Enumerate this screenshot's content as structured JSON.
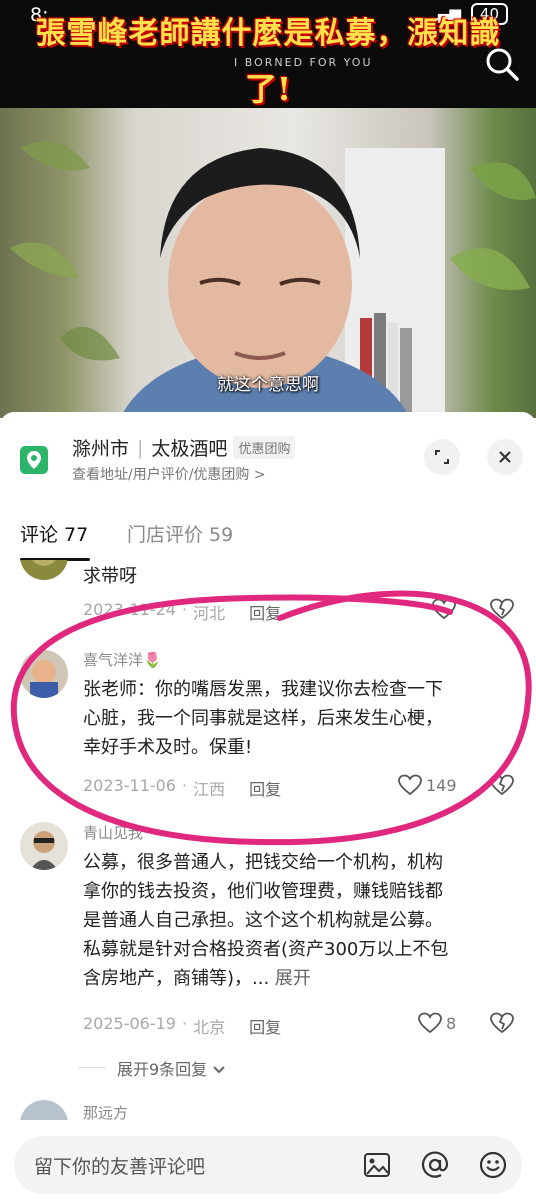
{
  "status_bar": {
    "time": "8:",
    "battery": "40"
  },
  "video": {
    "title_line1": "張雪峰老師講什麼是私募，漲知識",
    "title_line2": "了!",
    "watermark": "I BORNED FOR YOU",
    "subtitle": "就这个意思啊"
  },
  "location": {
    "city": "滁州市",
    "place": "太极酒吧",
    "tag": "优惠团购",
    "subline": "查看地址/用户评价/优惠团购 >"
  },
  "tabs": [
    {
      "label": "评论 77"
    },
    {
      "label": "门店评价 59"
    }
  ],
  "comments": [
    {
      "name": "",
      "text": "求带呀",
      "date": "2023-11-24",
      "region": "河北",
      "reply": "回复",
      "likes": ""
    },
    {
      "name": "喜气洋洋🌷",
      "text_lines": [
        "张老师：你的嘴唇发黑，我建议你去检查一下",
        "心脏，我一个同事就是这样，后来发生心梗，",
        "幸好手术及时。保重!"
      ],
      "date": "2023-11-06",
      "region": "江西",
      "reply": "回复",
      "likes": "149"
    },
    {
      "name": "青山见我",
      "text_lines": [
        "公募，很多普通人，把钱交给一个机构，机构",
        "拿你的钱去投资，他们收管理费，赚钱赔钱都",
        "是普通人自己承担。这个这个机构就是公募。",
        "私募就是针对合格投资者(资产300万以上不包",
        "含房地产，商铺等)，... "
      ],
      "expand_label": "展开",
      "date": "2025-06-19",
      "region": "北京",
      "reply": "回复",
      "likes": "8",
      "more_replies": "展开9条回复"
    },
    {
      "name": "那远方"
    }
  ],
  "input": {
    "placeholder": "留下你的友善评论吧"
  },
  "colors": {
    "accent_green": "#2cb56a",
    "annotation_magenta": "#e0287e"
  },
  "icons": [
    "search-icon",
    "location-pin-icon",
    "expand-icon",
    "close-icon",
    "heart-icon",
    "dislike-heart-icon",
    "chevron-down-icon",
    "image-icon",
    "at-icon",
    "emoji-icon"
  ]
}
